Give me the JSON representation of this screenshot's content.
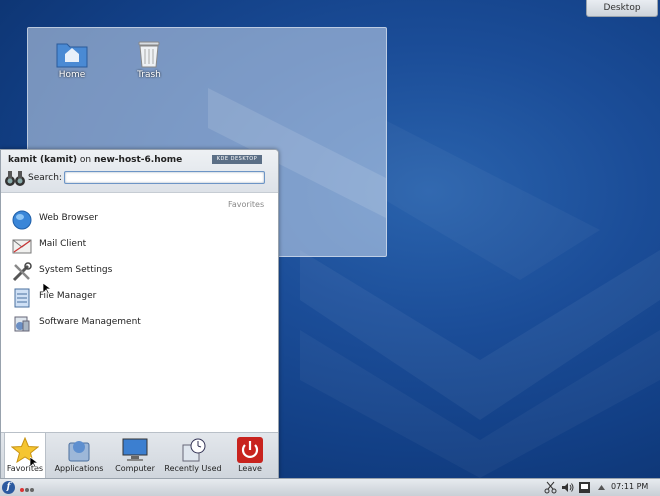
{
  "desktop": {
    "toolbox_label": "Desktop",
    "icons": [
      {
        "label": "Home",
        "icon": "home-folder-icon"
      },
      {
        "label": "Trash",
        "icon": "trash-icon"
      }
    ]
  },
  "kickoff": {
    "user": "kamit (kamit)",
    "on": "on",
    "host": "new-host-6.home",
    "logo_left": "KDE",
    "logo_right": "DESKTOP",
    "search_label": "Search:",
    "search_value": "",
    "section_title": "Favorites",
    "favorites": [
      {
        "label": "Web Browser",
        "icon": "globe-icon"
      },
      {
        "label": "Mail Client",
        "icon": "mail-icon"
      },
      {
        "label": "System Settings",
        "icon": "settings-icon"
      },
      {
        "label": "File Manager",
        "icon": "file-manager-icon"
      },
      {
        "label": "Software Management",
        "icon": "software-icon"
      }
    ],
    "tabs": [
      {
        "label": "Favorites",
        "icon": "star-icon",
        "active": true
      },
      {
        "label": "Applications",
        "icon": "applications-icon",
        "active": false
      },
      {
        "label": "Computer",
        "icon": "computer-icon",
        "active": false
      },
      {
        "label": "Recently Used",
        "icon": "clock-icon",
        "active": false
      },
      {
        "label": "Leave",
        "icon": "power-icon",
        "active": false
      }
    ]
  },
  "panel": {
    "launcher_glyph": "f",
    "clock": "07:11 PM"
  },
  "colors": {
    "desktop_blue": "#1b4d98",
    "accent": "#2c5aa0",
    "leave_red": "#c8231e"
  }
}
